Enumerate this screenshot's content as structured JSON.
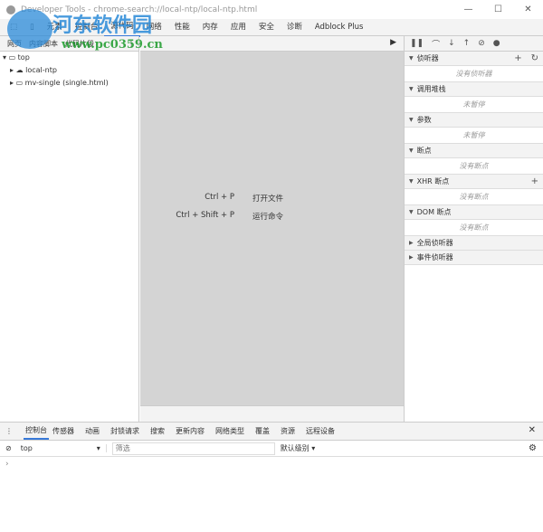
{
  "window": {
    "title": "Developer Tools - chrome-search://local-ntp/local-ntp.html",
    "minimize": "—",
    "maximize": "☐",
    "close": "✕"
  },
  "tabs": [
    "元素",
    "控制台",
    "源代码",
    "网络",
    "性能",
    "内存",
    "应用",
    "安全",
    "诊断",
    "Adblock Plus"
  ],
  "navigator": {
    "tabs": [
      "网页",
      "内容脚本",
      "代码片段"
    ],
    "tree": [
      "top",
      "local-ntp",
      "mv-single (single.html)"
    ]
  },
  "editor": {
    "hints": [
      {
        "keys": "Ctrl + P",
        "action": "打开文件"
      },
      {
        "keys": "Ctrl + Shift + P",
        "action": "运行命令"
      }
    ]
  },
  "debugger": {
    "sections": [
      {
        "title": "侦听器",
        "expanded": true,
        "empty": "没有侦听器"
      },
      {
        "title": "调用堆栈",
        "expanded": true,
        "empty": "未暂停"
      },
      {
        "title": "参数",
        "expanded": true,
        "empty": "未暂停"
      },
      {
        "title": "断点",
        "expanded": true,
        "empty": "没有断点"
      },
      {
        "title": "XHR 断点",
        "expanded": true,
        "empty": "没有断点"
      },
      {
        "title": "DOM 断点",
        "expanded": true,
        "empty": "没有断点"
      },
      {
        "title": "全局侦听器",
        "expanded": false
      },
      {
        "title": "事件侦听器",
        "expanded": false
      }
    ]
  },
  "drawer": {
    "tabs": [
      "控制台",
      "传感器",
      "动画",
      "封锁请求",
      "搜索",
      "更新内容",
      "网络类型",
      "覆盖",
      "资源",
      "远程设备"
    ],
    "context": "top",
    "filter_placeholder": "筛选",
    "level": "默认级别",
    "prompt": "›"
  },
  "watermark": {
    "name": "河东软件园",
    "url": "www.pc0359.cn"
  }
}
